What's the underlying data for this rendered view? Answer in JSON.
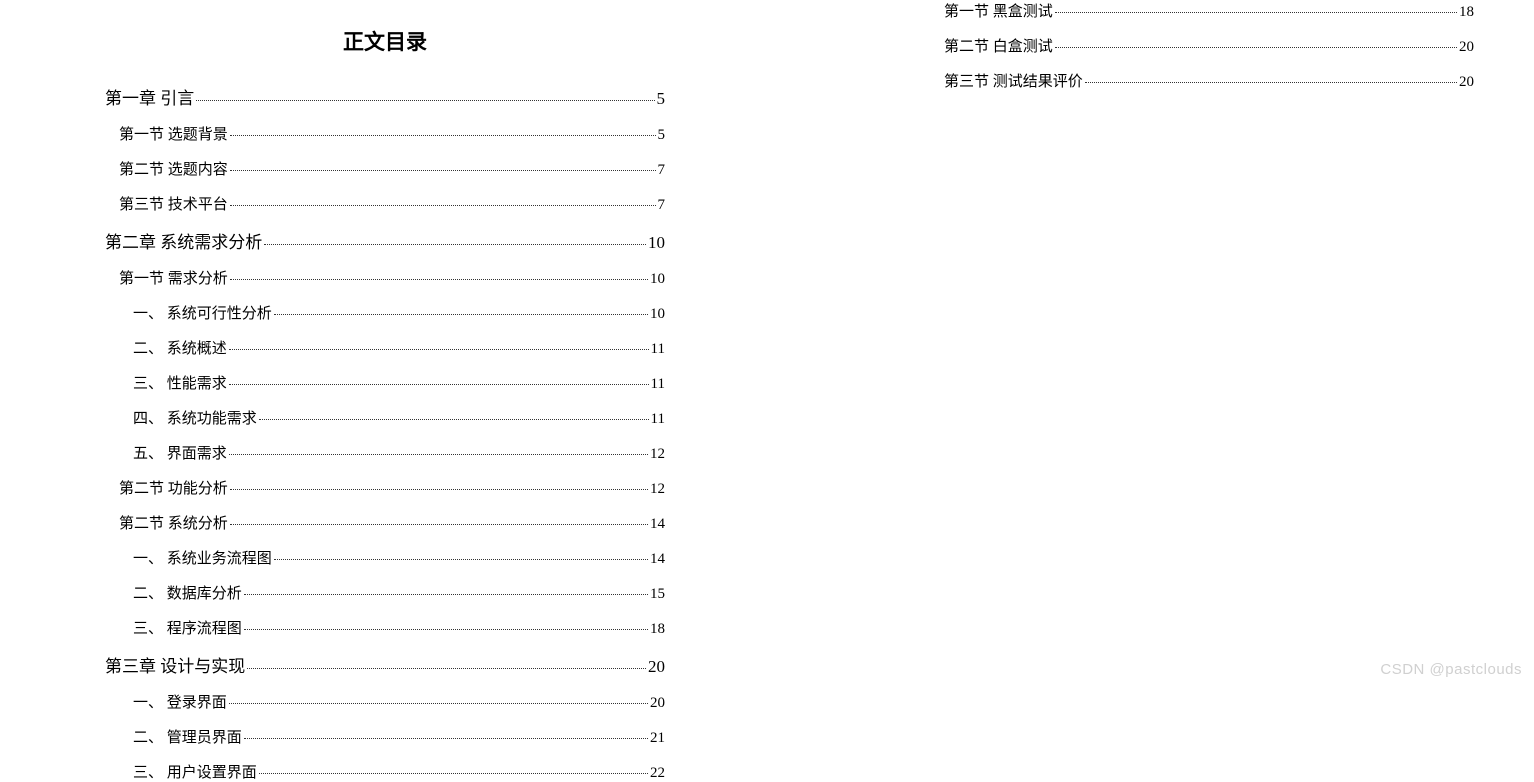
{
  "toolbar": {
    "icon_name": "document-icon"
  },
  "toc": {
    "title": "正文目录",
    "left_entries": [
      {
        "level": 1,
        "label": "第一章  引言",
        "page": "5"
      },
      {
        "level": 2,
        "label": "第一节  选题背景",
        "page": "5"
      },
      {
        "level": 2,
        "label": "第二节  选题内容",
        "page": "7"
      },
      {
        "level": 2,
        "label": "第三节  技术平台",
        "page": "7"
      },
      {
        "level": 1,
        "label": "第二章  系统需求分析",
        "page": "10"
      },
      {
        "level": 2,
        "label": "第一节  需求分析",
        "page": "10"
      },
      {
        "level": 3,
        "label": "一、  系统可行性分析",
        "page": "10"
      },
      {
        "level": 3,
        "label": "二、  系统概述",
        "page": "11"
      },
      {
        "level": 3,
        "label": "三、  性能需求",
        "page": "11"
      },
      {
        "level": 3,
        "label": "四、  系统功能需求",
        "page": "11"
      },
      {
        "level": 3,
        "label": "五、  界面需求",
        "page": "12"
      },
      {
        "level": 2,
        "label": "第二节  功能分析",
        "page": "12"
      },
      {
        "level": 2,
        "label": "第二节  系统分析",
        "page": "14"
      },
      {
        "level": 3,
        "label": "一、  系统业务流程图",
        "page": "14"
      },
      {
        "level": 3,
        "label": "二、  数据库分析",
        "page": "15"
      },
      {
        "level": 3,
        "label": "三、  程序流程图",
        "page": "18"
      },
      {
        "level": 1,
        "label": "第三章  设计与实现",
        "page": "20"
      },
      {
        "level": 3,
        "label": "一、  登录界面",
        "page": "20"
      },
      {
        "level": 3,
        "label": "二、  管理员界面",
        "page": "21"
      },
      {
        "level": 3,
        "label": "三、  用户设置界面",
        "page": "22"
      }
    ],
    "right_entries": [
      {
        "level": 2,
        "label": "第一节  黑盒测试",
        "page": "18"
      },
      {
        "level": 2,
        "label": "第二节  白盒测试",
        "page": "20"
      },
      {
        "level": 2,
        "label": "第三节  测试结果评价",
        "page": "20"
      }
    ]
  },
  "watermark": "CSDN @pastclouds"
}
